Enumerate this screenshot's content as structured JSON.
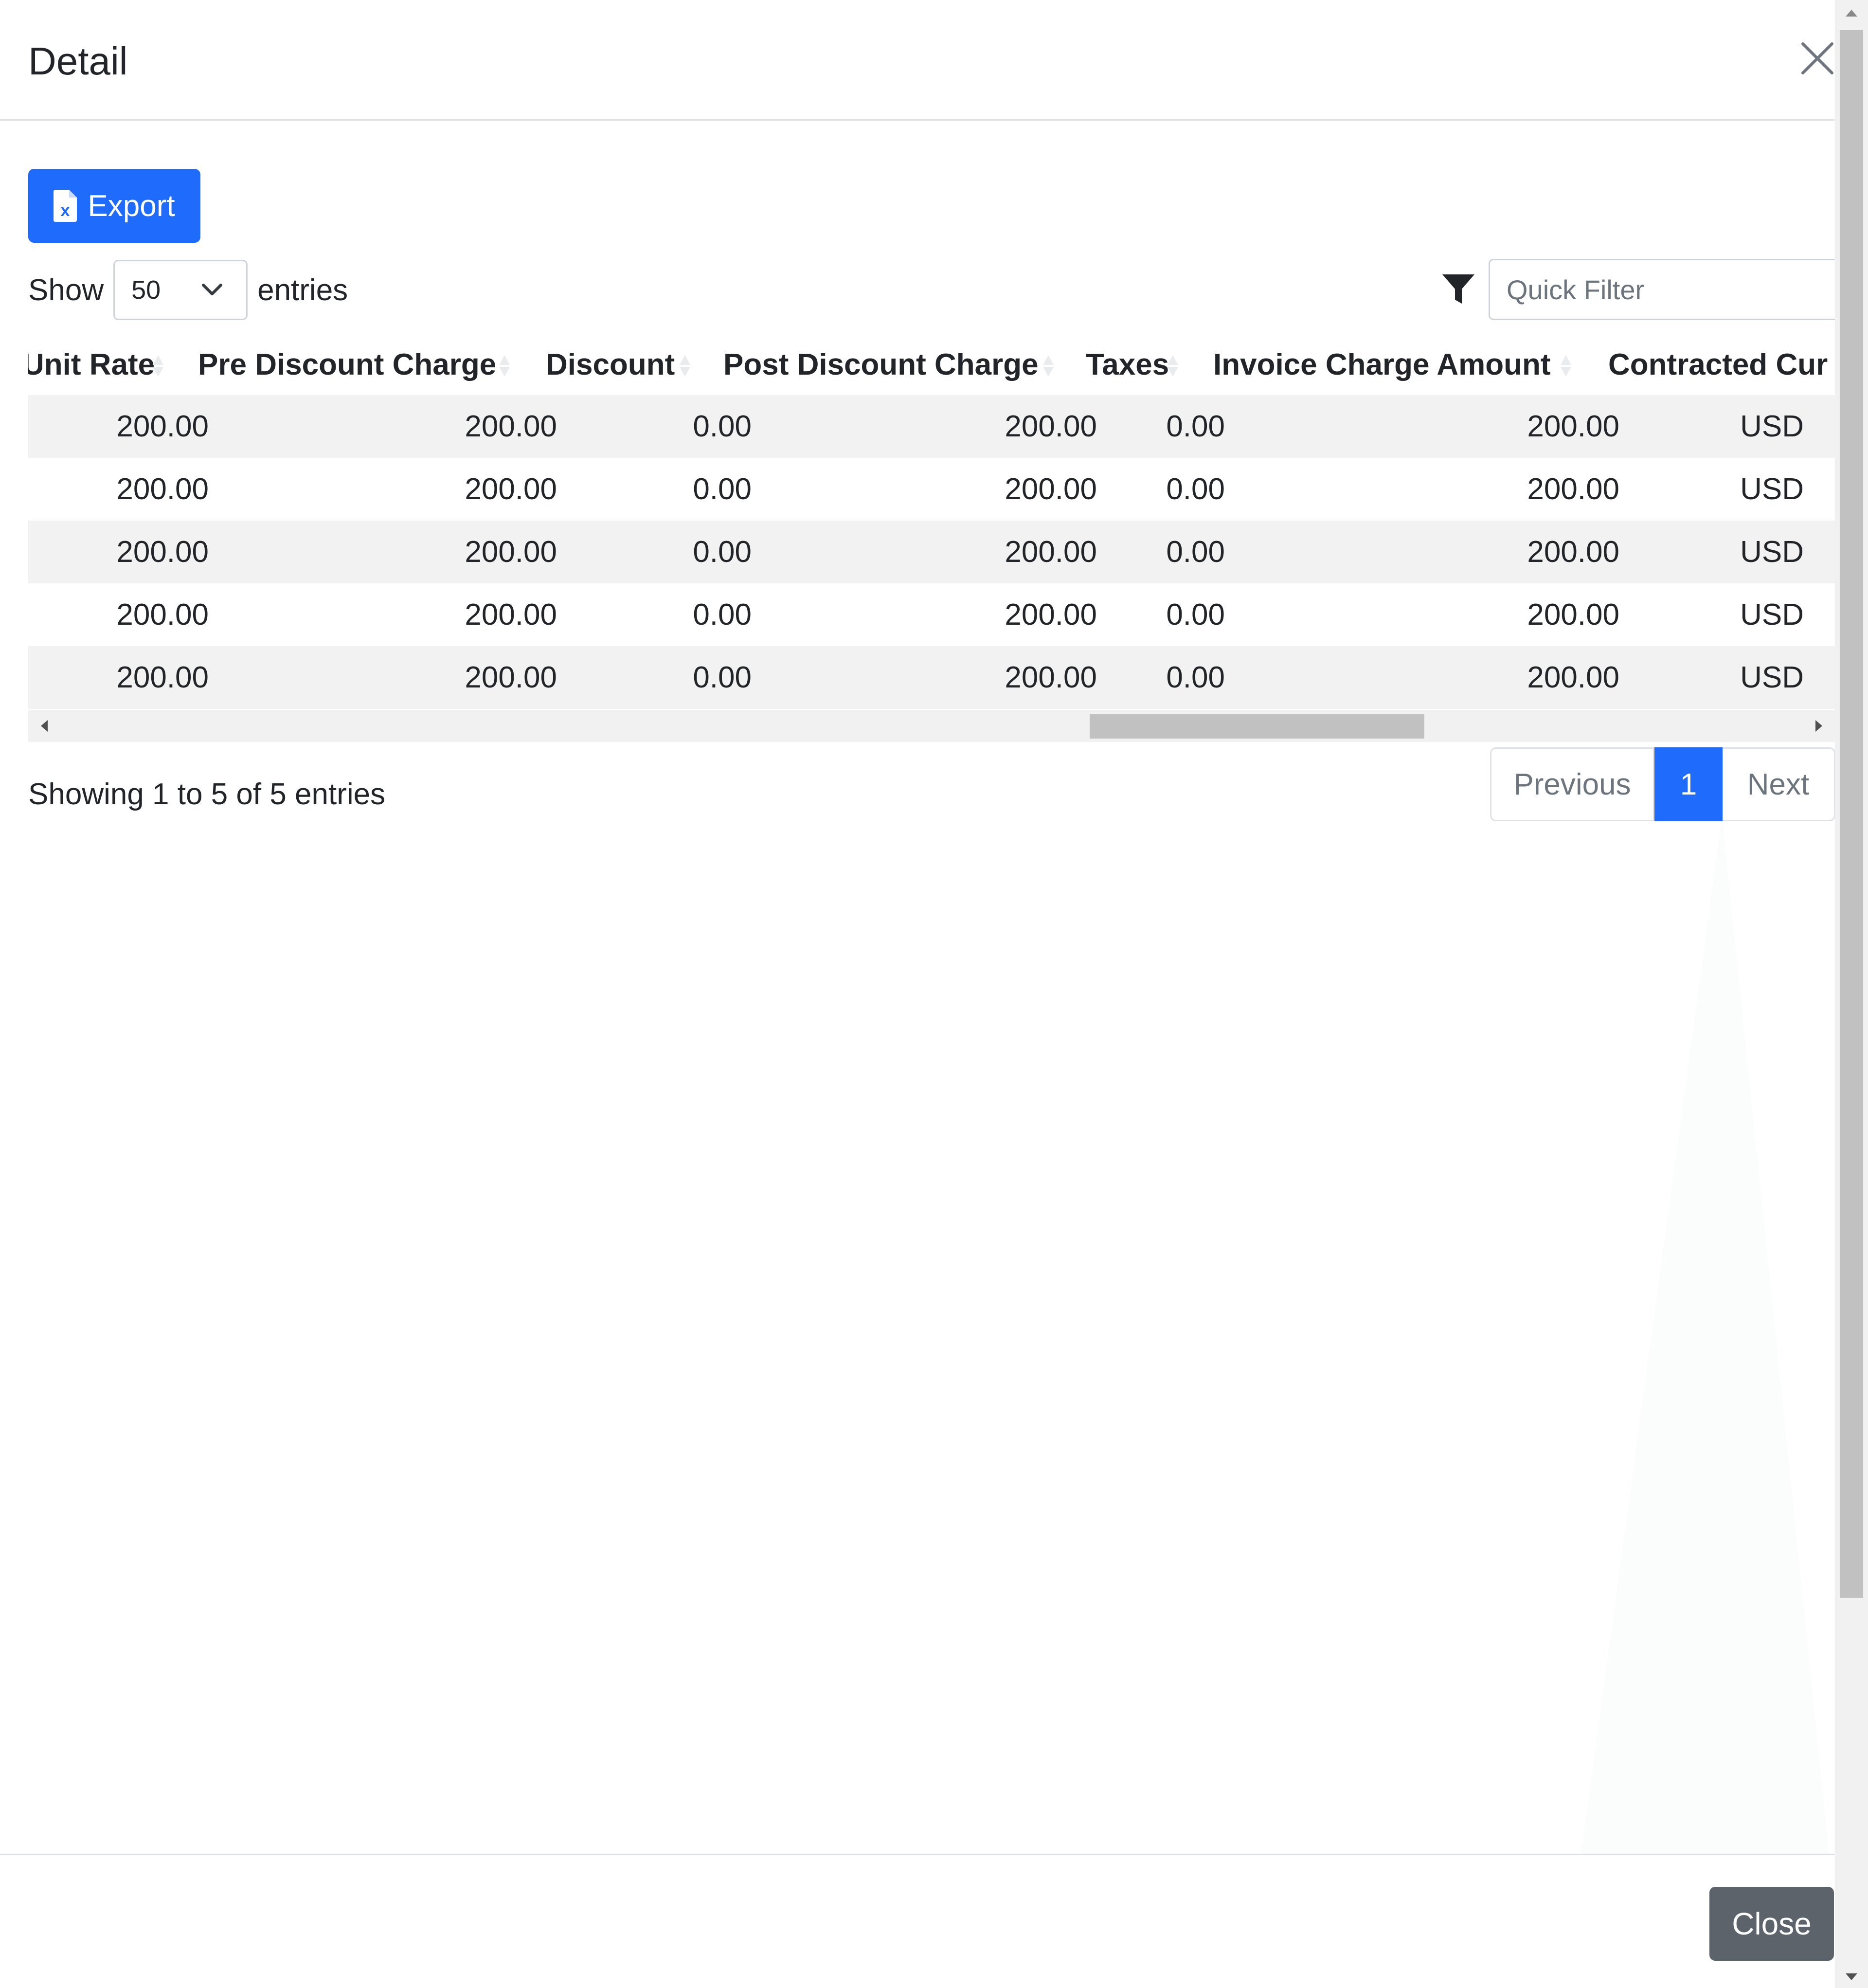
{
  "modal": {
    "title": "Detail",
    "close_label": "Close"
  },
  "toolbar": {
    "export_label": "Export",
    "show_label": "Show",
    "entries_label": "entries",
    "page_size": "50",
    "quick_filter_placeholder": "Quick Filter"
  },
  "table": {
    "columns": [
      "Unit Rate",
      "Pre Discount Charge",
      "Discount",
      "Post Discount Charge",
      "Taxes",
      "Invoice Charge Amount",
      "Contracted Cur"
    ],
    "rows": [
      [
        "200.00",
        "200.00",
        "0.00",
        "200.00",
        "0.00",
        "200.00",
        "USD"
      ],
      [
        "200.00",
        "200.00",
        "0.00",
        "200.00",
        "0.00",
        "200.00",
        "USD"
      ],
      [
        "200.00",
        "200.00",
        "0.00",
        "200.00",
        "0.00",
        "200.00",
        "USD"
      ],
      [
        "200.00",
        "200.00",
        "0.00",
        "200.00",
        "0.00",
        "200.00",
        "USD"
      ],
      [
        "200.00",
        "200.00",
        "0.00",
        "200.00",
        "0.00",
        "200.00",
        "USD"
      ]
    ]
  },
  "footer_info": "Showing 1 to 5 of 5 entries",
  "pagination": {
    "previous": "Previous",
    "current": "1",
    "next": "Next"
  },
  "colors": {
    "primary": "#1f6bfb",
    "secondary": "#5c636a",
    "stripe": "#f2f2f2"
  },
  "icons": {
    "export": "excel-file-icon",
    "filter": "filter-icon",
    "close": "close-icon",
    "select": "chevron-down-icon",
    "sort": "sort-icon"
  }
}
